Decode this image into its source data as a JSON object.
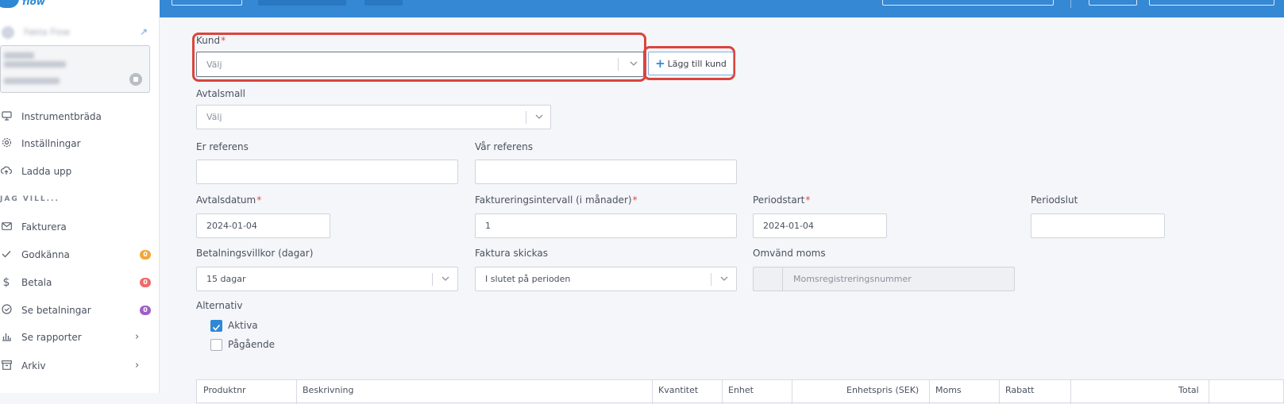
{
  "brand": {
    "logo_text": "flow"
  },
  "sidebar": {
    "company_name": "Fakta Flow",
    "section_label": "JAG VILL...",
    "items": [
      {
        "label": "Instrumentbräda",
        "icon": "monitor-icon"
      },
      {
        "label": "Inställningar",
        "icon": "gear-icon"
      },
      {
        "label": "Ladda upp",
        "icon": "cloud-upload-icon"
      },
      {
        "label": "Fakturera",
        "icon": "envelope-icon"
      },
      {
        "label": "Godkänna",
        "icon": "check-icon",
        "badge": "0",
        "badge_color": "#f0a83a"
      },
      {
        "label": "Betala",
        "icon": "dollar-icon",
        "badge": "0",
        "badge_color": "#ef6a6a"
      },
      {
        "label": "Se betalningar",
        "icon": "check-circle-icon",
        "badge": "0",
        "badge_color": "#a05fc8"
      },
      {
        "label": "Se rapporter",
        "icon": "bar-chart-icon",
        "chevron": "›"
      },
      {
        "label": "Arkiv",
        "icon": "archive-icon",
        "chevron": "›"
      }
    ]
  },
  "form": {
    "kund": {
      "label": "Kund",
      "required": "*",
      "placeholder": "Välj"
    },
    "add_customer_label": "Lägg till kund",
    "avtalsmall": {
      "label": "Avtalsmall",
      "placeholder": "Välj"
    },
    "er_referens": {
      "label": "Er referens",
      "value": ""
    },
    "var_referens": {
      "label": "Vår referens",
      "value": ""
    },
    "avtalsdatum": {
      "label": "Avtalsdatum",
      "required": "*",
      "value": "2024-01-04"
    },
    "faktureringsintervall": {
      "label": "Faktureringsintervall (i månader)",
      "required": "*",
      "value": "1"
    },
    "periodstart": {
      "label": "Periodstart",
      "required": "*",
      "value": "2024-01-04"
    },
    "periodslut": {
      "label": "Periodslut",
      "value": ""
    },
    "betalningsvillkor": {
      "label": "Betalningsvillkor (dagar)",
      "value": "15 dagar"
    },
    "faktura_skickas": {
      "label": "Faktura skickas",
      "value": "I slutet på perioden"
    },
    "omvand_moms": {
      "label": "Omvänd moms",
      "placeholder": "Momsregistreringsnummer"
    },
    "alternativ": {
      "label": "Alternativ",
      "options": [
        {
          "label": "Aktiva",
          "checked": true
        },
        {
          "label": "Pågående",
          "checked": false
        }
      ]
    }
  },
  "table": {
    "headers": [
      "Produktnr",
      "Beskrivning",
      "Kvantitet",
      "Enhet",
      "Enhetspris (SEK)",
      "Moms",
      "Rabatt",
      "Total"
    ]
  },
  "colors": {
    "accent": "#3588d4",
    "highlight": "#d9453d",
    "required": "#e04848"
  }
}
